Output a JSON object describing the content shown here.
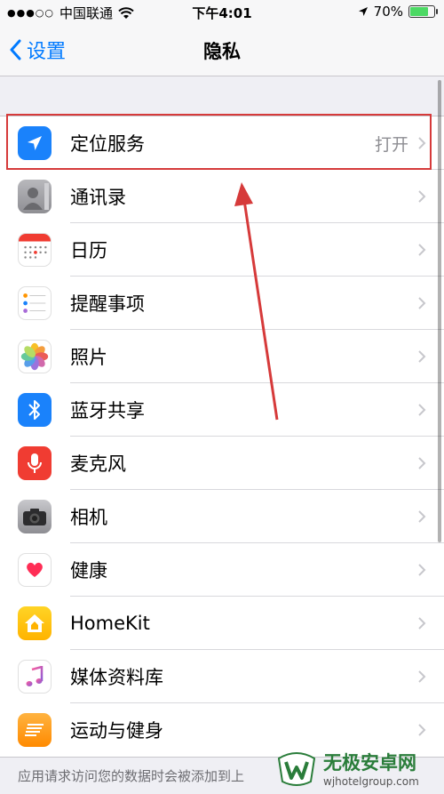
{
  "status": {
    "signal_dots": "●●●○○",
    "carrier": "中国联通",
    "time": "下午4:01",
    "battery_percent": "70%",
    "battery_level": 0.7
  },
  "nav": {
    "back_label": "设置",
    "title": "隐私"
  },
  "items": [
    {
      "label": "定位服务",
      "value": "打开",
      "icon": "location-arrow-icon",
      "color": "#1a82fb"
    },
    {
      "label": "通讯录",
      "value": "",
      "icon": "contacts-icon",
      "color": "#9a9a9e"
    },
    {
      "label": "日历",
      "value": "",
      "icon": "calendar-icon",
      "color": "#ffffff"
    },
    {
      "label": "提醒事项",
      "value": "",
      "icon": "reminders-icon",
      "color": "#ffffff"
    },
    {
      "label": "照片",
      "value": "",
      "icon": "photos-icon",
      "color": "#ffffff"
    },
    {
      "label": "蓝牙共享",
      "value": "",
      "icon": "bluetooth-icon",
      "color": "#1a82fb"
    },
    {
      "label": "麦克风",
      "value": "",
      "icon": "microphone-icon",
      "color": "#f03c32"
    },
    {
      "label": "相机",
      "value": "",
      "icon": "camera-icon",
      "color": "#8e8e93"
    },
    {
      "label": "健康",
      "value": "",
      "icon": "health-heart-icon",
      "color": "#ffffff"
    },
    {
      "label": "HomeKit",
      "value": "",
      "icon": "homekit-icon",
      "color": "#ffcc00"
    },
    {
      "label": "媒体资料库",
      "value": "",
      "icon": "music-note-icon",
      "color": "#ffffff"
    },
    {
      "label": "运动与健身",
      "value": "",
      "icon": "motion-fitness-icon",
      "color": "#ff9500"
    }
  ],
  "footer_text": "应用请求访问您的数据时会被添加到上",
  "watermark": {
    "name": "无极安卓网",
    "url": "wjhotelgroup.com"
  },
  "annotation_color": "#d63a3a"
}
